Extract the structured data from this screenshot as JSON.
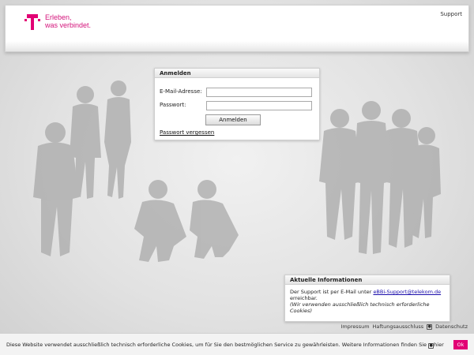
{
  "header": {
    "slogan_line1": "Erleben,",
    "slogan_line2": "was verbindet.",
    "support_label": "Support",
    "brand_color": "#e20074"
  },
  "login": {
    "title": "Anmelden",
    "email_label": "E-Mail-Adresse:",
    "email_value": "",
    "password_label": "Passwort:",
    "password_value": "",
    "submit_label": "Anmelden",
    "forgot_label": "Passwort vergessen"
  },
  "info": {
    "title": "Aktuelle Informationen",
    "text_before": "Der Support ist per E-Mail unter",
    "email_link": "eBBi-Support@telekom.de",
    "text_after": "erreichbar.",
    "note": "(Wir verwenden ausschließlich technisch erforderliche Cookies)"
  },
  "footer": {
    "impressum": "Impressum",
    "haftung": "Haftungsausschluss",
    "datenschutz": "Datenschutz",
    "a11y_icon": "accessibility-icon"
  },
  "cookie": {
    "text": "Diese Website verwendet ausschließlich technisch erforderliche Cookies, um für Sie den bestmöglichen Service zu gewährleisten. Weitere Informationen finden Sie",
    "link_label": "hier",
    "ok_label": "Ok",
    "ok_color": "#e20074"
  }
}
